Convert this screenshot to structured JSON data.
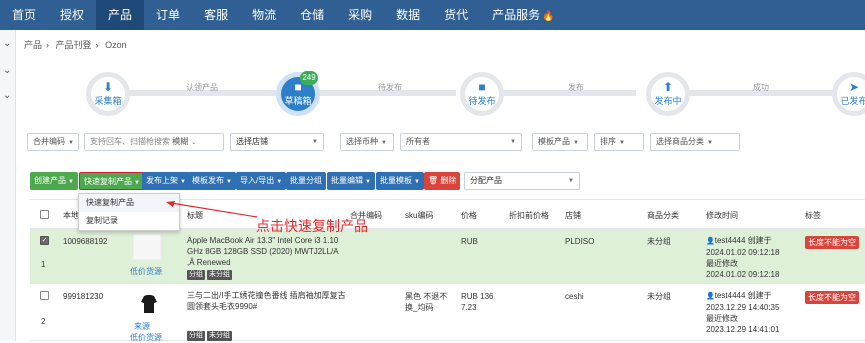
{
  "nav": {
    "items": [
      "首页",
      "授权",
      "产品",
      "订单",
      "客服",
      "物流",
      "仓储",
      "采购",
      "数据",
      "货代",
      "产品服务"
    ],
    "active": "产品",
    "fire_icon": "fire-icon"
  },
  "breadcrumb": [
    "产品",
    "产品刊登",
    "Ozon"
  ],
  "steps": {
    "items": [
      {
        "label": "采集箱",
        "icon": "download-icon"
      },
      {
        "label": "草稿箱",
        "icon": "folder-icon",
        "badge": "249",
        "active": true
      },
      {
        "label": "待发布",
        "icon": "folder-icon"
      },
      {
        "label": "发布中",
        "icon": "upload-icon"
      },
      {
        "label": "已发布",
        "icon": "send-icon"
      }
    ],
    "connectors": [
      "认领产品",
      "待发布",
      "发布",
      "成功"
    ]
  },
  "filters": {
    "merge_code": "合并编码",
    "search_placeholder": "支持回车、扫描枪搜索",
    "search_mode": "模糊",
    "store": "选择店铺",
    "currency": "选择币种",
    "owner": "所有者",
    "template": "模板产品",
    "sort": "排序",
    "category": "选择商品分类"
  },
  "toolbar": {
    "create": "创建产品",
    "quick_copy": "快速复制产品",
    "publish": "发布上架",
    "template_publish": "模板发布",
    "import_export": "导入/导出",
    "batch_group": "批量分组",
    "batch_edit": "批量编辑",
    "batch_template": "批量模板",
    "delete": "删除",
    "assign": "分配产品"
  },
  "dropdown": {
    "items": [
      "快速复制产品",
      "复制记录"
    ]
  },
  "annotation": "点击快速复制产品",
  "table": {
    "headers": {
      "local": "本地",
      "title": "标题",
      "merge_code": "合并编码",
      "sku": "sku编码",
      "price": "价格",
      "discount_price": "折扣前价格",
      "store": "店铺",
      "category": "商品分类",
      "modified": "修改时间",
      "label": "标签"
    },
    "rows": [
      {
        "index": "1",
        "id": "1009688192",
        "source": "低价货源",
        "title": "Apple MacBook Air 13.3\" Intel Core i3 1.10 GHz 8GB 128GB SSD (2020) MWTJ2LL/A ,Â Renewed",
        "tags": [
          "分组",
          "未分组"
        ],
        "sku": "",
        "price": "RUB",
        "store": "PLDISO",
        "category": "未分组",
        "creator": "test4444 创建于",
        "created": "2024.01.02 09:12:18",
        "modified_label": "最近修改",
        "modified": "2024.01.02 09:12:18",
        "badge": "长度不能为空"
      },
      {
        "index": "2",
        "id": "999181230",
        "source_top": "来源",
        "source": "低价货源",
        "title": "三与二出/I手工绣花撞色番线 插肩袖加厚复古圆领套头毛衣9990#",
        "tags": [
          "分组",
          "未分组"
        ],
        "sku": "黑色 不退不换_均码",
        "price": "RUB 136 7.23",
        "store": "ceshi",
        "category": "未分组",
        "creator": "test4444 创建于",
        "created": "2023.12.29 14:40:35",
        "modified_label": "最近修改",
        "modified": "2023.12.29 14:41:01",
        "badge": "长度不能为空"
      }
    ]
  }
}
